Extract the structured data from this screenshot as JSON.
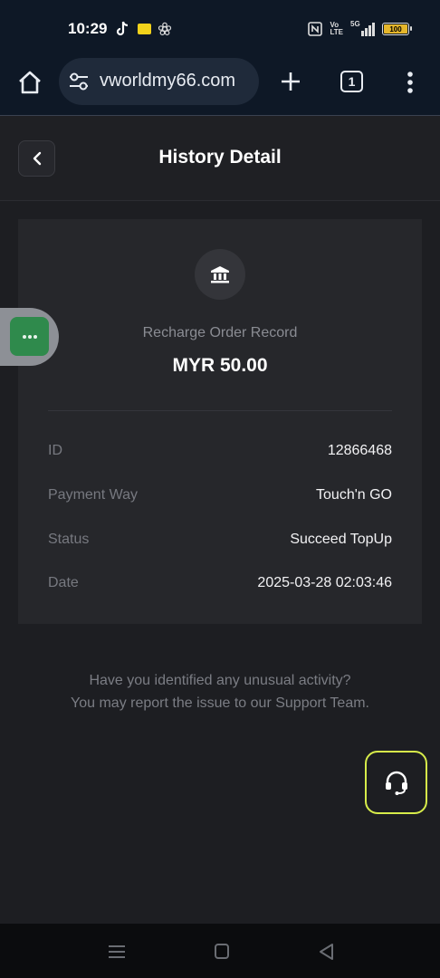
{
  "status_bar": {
    "time": "10:29",
    "battery": "100",
    "network": "5G"
  },
  "browser": {
    "url": "vworldmy66.com",
    "tab_count": "1"
  },
  "header": {
    "title": "History Detail"
  },
  "record": {
    "subtitle": "Recharge Order Record",
    "amount": "MYR 50.00",
    "rows": [
      {
        "label": "ID",
        "value": "12866468"
      },
      {
        "label": "Payment Way",
        "value": "Touch'n GO"
      },
      {
        "label": "Status",
        "value": "Succeed TopUp"
      },
      {
        "label": "Date",
        "value": "2025-03-28 02:03:46"
      }
    ]
  },
  "notice": {
    "line1": "Have you identified any unusual activity?",
    "line2": "You may report the issue to our Support Team."
  },
  "colors": {
    "accent_border": "#d7ec4a",
    "chat_green": "#2f8a4c",
    "background": "#1d1e22",
    "card": "#26272b"
  },
  "icons": [
    "home-icon",
    "site-settings-icon",
    "plus-icon",
    "tabs-icon",
    "more-vert-icon",
    "back-chevron-icon",
    "bank-icon",
    "chat-dots-icon",
    "headset-icon"
  ]
}
